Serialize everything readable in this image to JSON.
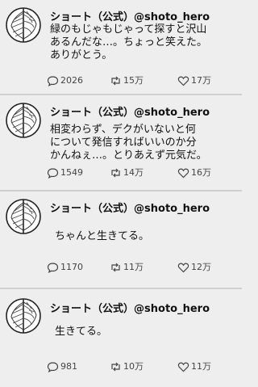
{
  "tweets": [
    {
      "display_name": "ショート（公式）",
      "handle": "@shoto_hero",
      "body": "緑のもじゃもじゃって探すと沢山\nあるんだな…。ちょっと笑えた。\nありがとう。",
      "replies": "2026",
      "retweets": "15万",
      "likes": "17万"
    },
    {
      "display_name": "ショート（公式）",
      "handle": "@shoto_hero",
      "body": "相変わらず、デクがいないと何\nについて発信すればいいのか分\nかんねぇ…。とりあえず元気だ。",
      "replies": "1549",
      "retweets": "14万",
      "likes": "16万"
    },
    {
      "display_name": "ショート（公式）",
      "handle": "@shoto_hero",
      "body": "ちゃんと生きてる。",
      "replies": "1170",
      "retweets": "11万",
      "likes": "12万"
    },
    {
      "display_name": "ショート（公式）",
      "handle": "@shoto_hero",
      "body": "生きてる。",
      "replies": "981",
      "retweets": "10万",
      "likes": "11万"
    }
  ],
  "icons": {
    "reply": "speech-bubble-icon",
    "retweet": "retweet-arrows-icon",
    "like": "heart-icon"
  }
}
